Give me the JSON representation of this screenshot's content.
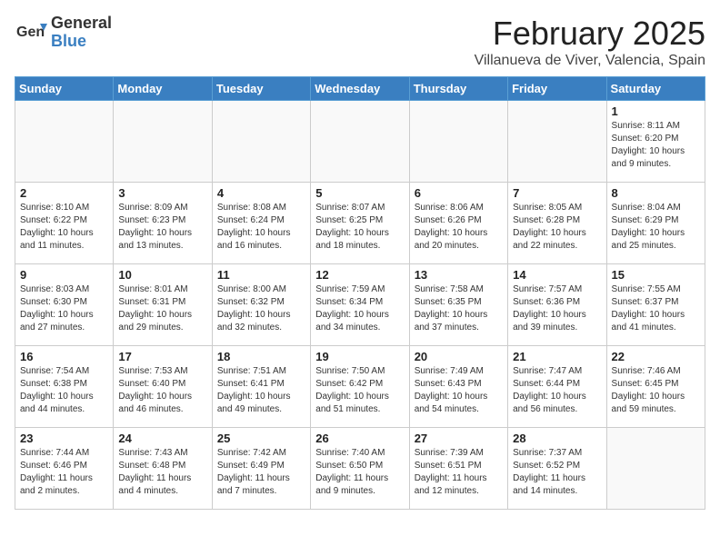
{
  "logo": {
    "general": "General",
    "blue": "Blue"
  },
  "title": "February 2025",
  "location": "Villanueva de Viver, Valencia, Spain",
  "weekdays": [
    "Sunday",
    "Monday",
    "Tuesday",
    "Wednesday",
    "Thursday",
    "Friday",
    "Saturday"
  ],
  "weeks": [
    [
      {
        "day": "",
        "info": ""
      },
      {
        "day": "",
        "info": ""
      },
      {
        "day": "",
        "info": ""
      },
      {
        "day": "",
        "info": ""
      },
      {
        "day": "",
        "info": ""
      },
      {
        "day": "",
        "info": ""
      },
      {
        "day": "1",
        "info": "Sunrise: 8:11 AM\nSunset: 6:20 PM\nDaylight: 10 hours\nand 9 minutes."
      }
    ],
    [
      {
        "day": "2",
        "info": "Sunrise: 8:10 AM\nSunset: 6:22 PM\nDaylight: 10 hours\nand 11 minutes."
      },
      {
        "day": "3",
        "info": "Sunrise: 8:09 AM\nSunset: 6:23 PM\nDaylight: 10 hours\nand 13 minutes."
      },
      {
        "day": "4",
        "info": "Sunrise: 8:08 AM\nSunset: 6:24 PM\nDaylight: 10 hours\nand 16 minutes."
      },
      {
        "day": "5",
        "info": "Sunrise: 8:07 AM\nSunset: 6:25 PM\nDaylight: 10 hours\nand 18 minutes."
      },
      {
        "day": "6",
        "info": "Sunrise: 8:06 AM\nSunset: 6:26 PM\nDaylight: 10 hours\nand 20 minutes."
      },
      {
        "day": "7",
        "info": "Sunrise: 8:05 AM\nSunset: 6:28 PM\nDaylight: 10 hours\nand 22 minutes."
      },
      {
        "day": "8",
        "info": "Sunrise: 8:04 AM\nSunset: 6:29 PM\nDaylight: 10 hours\nand 25 minutes."
      }
    ],
    [
      {
        "day": "9",
        "info": "Sunrise: 8:03 AM\nSunset: 6:30 PM\nDaylight: 10 hours\nand 27 minutes."
      },
      {
        "day": "10",
        "info": "Sunrise: 8:01 AM\nSunset: 6:31 PM\nDaylight: 10 hours\nand 29 minutes."
      },
      {
        "day": "11",
        "info": "Sunrise: 8:00 AM\nSunset: 6:32 PM\nDaylight: 10 hours\nand 32 minutes."
      },
      {
        "day": "12",
        "info": "Sunrise: 7:59 AM\nSunset: 6:34 PM\nDaylight: 10 hours\nand 34 minutes."
      },
      {
        "day": "13",
        "info": "Sunrise: 7:58 AM\nSunset: 6:35 PM\nDaylight: 10 hours\nand 37 minutes."
      },
      {
        "day": "14",
        "info": "Sunrise: 7:57 AM\nSunset: 6:36 PM\nDaylight: 10 hours\nand 39 minutes."
      },
      {
        "day": "15",
        "info": "Sunrise: 7:55 AM\nSunset: 6:37 PM\nDaylight: 10 hours\nand 41 minutes."
      }
    ],
    [
      {
        "day": "16",
        "info": "Sunrise: 7:54 AM\nSunset: 6:38 PM\nDaylight: 10 hours\nand 44 minutes."
      },
      {
        "day": "17",
        "info": "Sunrise: 7:53 AM\nSunset: 6:40 PM\nDaylight: 10 hours\nand 46 minutes."
      },
      {
        "day": "18",
        "info": "Sunrise: 7:51 AM\nSunset: 6:41 PM\nDaylight: 10 hours\nand 49 minutes."
      },
      {
        "day": "19",
        "info": "Sunrise: 7:50 AM\nSunset: 6:42 PM\nDaylight: 10 hours\nand 51 minutes."
      },
      {
        "day": "20",
        "info": "Sunrise: 7:49 AM\nSunset: 6:43 PM\nDaylight: 10 hours\nand 54 minutes."
      },
      {
        "day": "21",
        "info": "Sunrise: 7:47 AM\nSunset: 6:44 PM\nDaylight: 10 hours\nand 56 minutes."
      },
      {
        "day": "22",
        "info": "Sunrise: 7:46 AM\nSunset: 6:45 PM\nDaylight: 10 hours\nand 59 minutes."
      }
    ],
    [
      {
        "day": "23",
        "info": "Sunrise: 7:44 AM\nSunset: 6:46 PM\nDaylight: 11 hours\nand 2 minutes."
      },
      {
        "day": "24",
        "info": "Sunrise: 7:43 AM\nSunset: 6:48 PM\nDaylight: 11 hours\nand 4 minutes."
      },
      {
        "day": "25",
        "info": "Sunrise: 7:42 AM\nSunset: 6:49 PM\nDaylight: 11 hours\nand 7 minutes."
      },
      {
        "day": "26",
        "info": "Sunrise: 7:40 AM\nSunset: 6:50 PM\nDaylight: 11 hours\nand 9 minutes."
      },
      {
        "day": "27",
        "info": "Sunrise: 7:39 AM\nSunset: 6:51 PM\nDaylight: 11 hours\nand 12 minutes."
      },
      {
        "day": "28",
        "info": "Sunrise: 7:37 AM\nSunset: 6:52 PM\nDaylight: 11 hours\nand 14 minutes."
      },
      {
        "day": "",
        "info": ""
      }
    ]
  ]
}
